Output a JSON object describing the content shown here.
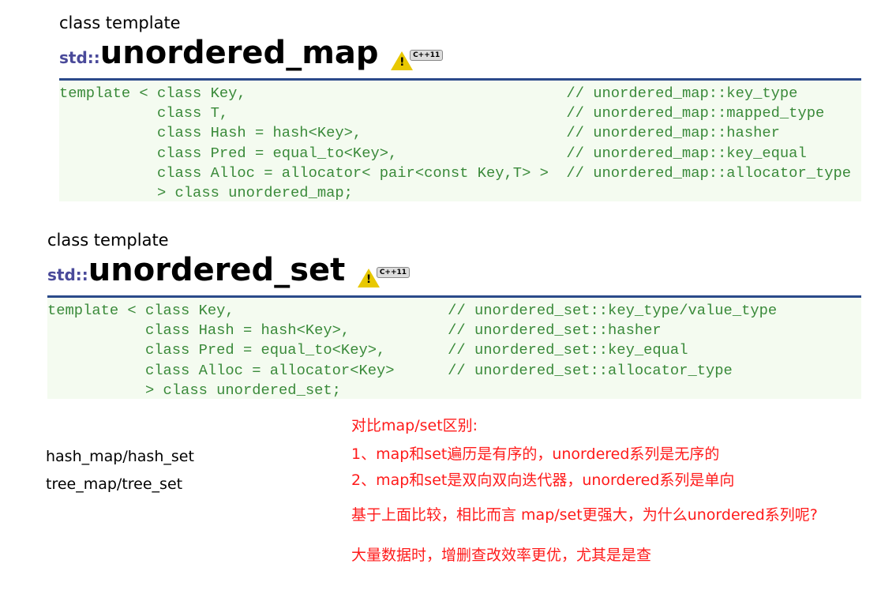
{
  "map_section": {
    "kind": "class template",
    "namespace": "std::",
    "name": "unordered_map",
    "badge": "C++11",
    "lines": [
      {
        "code": "template < class Key,",
        "comment": "// unordered_map::key_type"
      },
      {
        "code": "class T,",
        "comment": "// unordered_map::mapped_type"
      },
      {
        "code": "class Hash = hash<Key>,",
        "comment": "// unordered_map::hasher"
      },
      {
        "code": "class Pred = equal_to<Key>,",
        "comment": "// unordered_map::key_equal"
      },
      {
        "code": "class Alloc = allocator< pair<const Key,T> >",
        "comment": "// unordered_map::allocator_type"
      },
      {
        "code": "> class unordered_map;",
        "comment": ""
      }
    ]
  },
  "set_section": {
    "kind": "class template",
    "namespace": "std::",
    "name": "unordered_set",
    "badge": "C++11",
    "lines": [
      {
        "code": "template < class Key,",
        "comment": "// unordered_set::key_type/value_type"
      },
      {
        "code": "class Hash = hash<Key>,",
        "comment": "// unordered_set::hasher"
      },
      {
        "code": "class Pred = equal_to<Key>,",
        "comment": "// unordered_set::key_equal"
      },
      {
        "code": "class Alloc = allocator<Key>",
        "comment": "// unordered_set::allocator_type"
      },
      {
        "code": "> class unordered_set;",
        "comment": ""
      }
    ]
  },
  "aliases": [
    "hash_map/hash_set",
    "tree_map/tree_set"
  ],
  "notes": {
    "heading": "对比map/set区别:",
    "point1": "1、map和set遍历是有序的，unordered系列是无序的",
    "point2": "2、map和set是双向双向迭代器，unordered系列是单向",
    "question": "基于上面比较，相比而言 map/set更强大，为什么unordered系列呢?",
    "answer": "大量数据时，增删查改效率更优，尤其是是查"
  },
  "colors": {
    "code": "#3a8a3a",
    "rule": "#2b4a8a",
    "note": "#ff1a1a",
    "namespace": "#4a4a9a"
  }
}
